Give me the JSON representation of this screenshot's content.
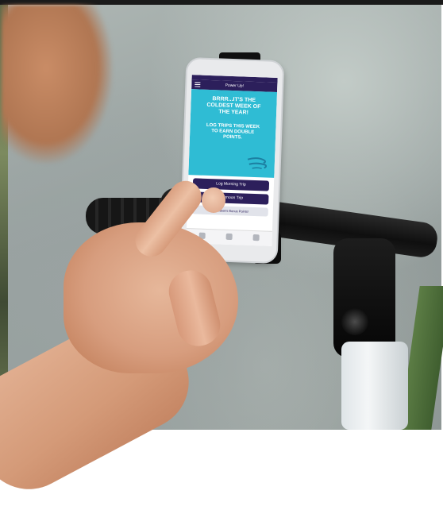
{
  "scene": "photo",
  "phone_screen": {
    "title": "Power Up!",
    "promo_headline": "BRRR...IT'S THE COLDEST WEEK OF THE YEAR!",
    "promo_subline": "LOG TRIPS THIS WEEK TO EARN DOUBLE POINTS.",
    "primary_button": "Log Morning Trip",
    "secondary_button": "Afternoon Trip",
    "info_button": "This week's Bonus Points!",
    "colors": {
      "brand": "#2c1f5b",
      "promo_bg": "#2fbcd4"
    }
  }
}
